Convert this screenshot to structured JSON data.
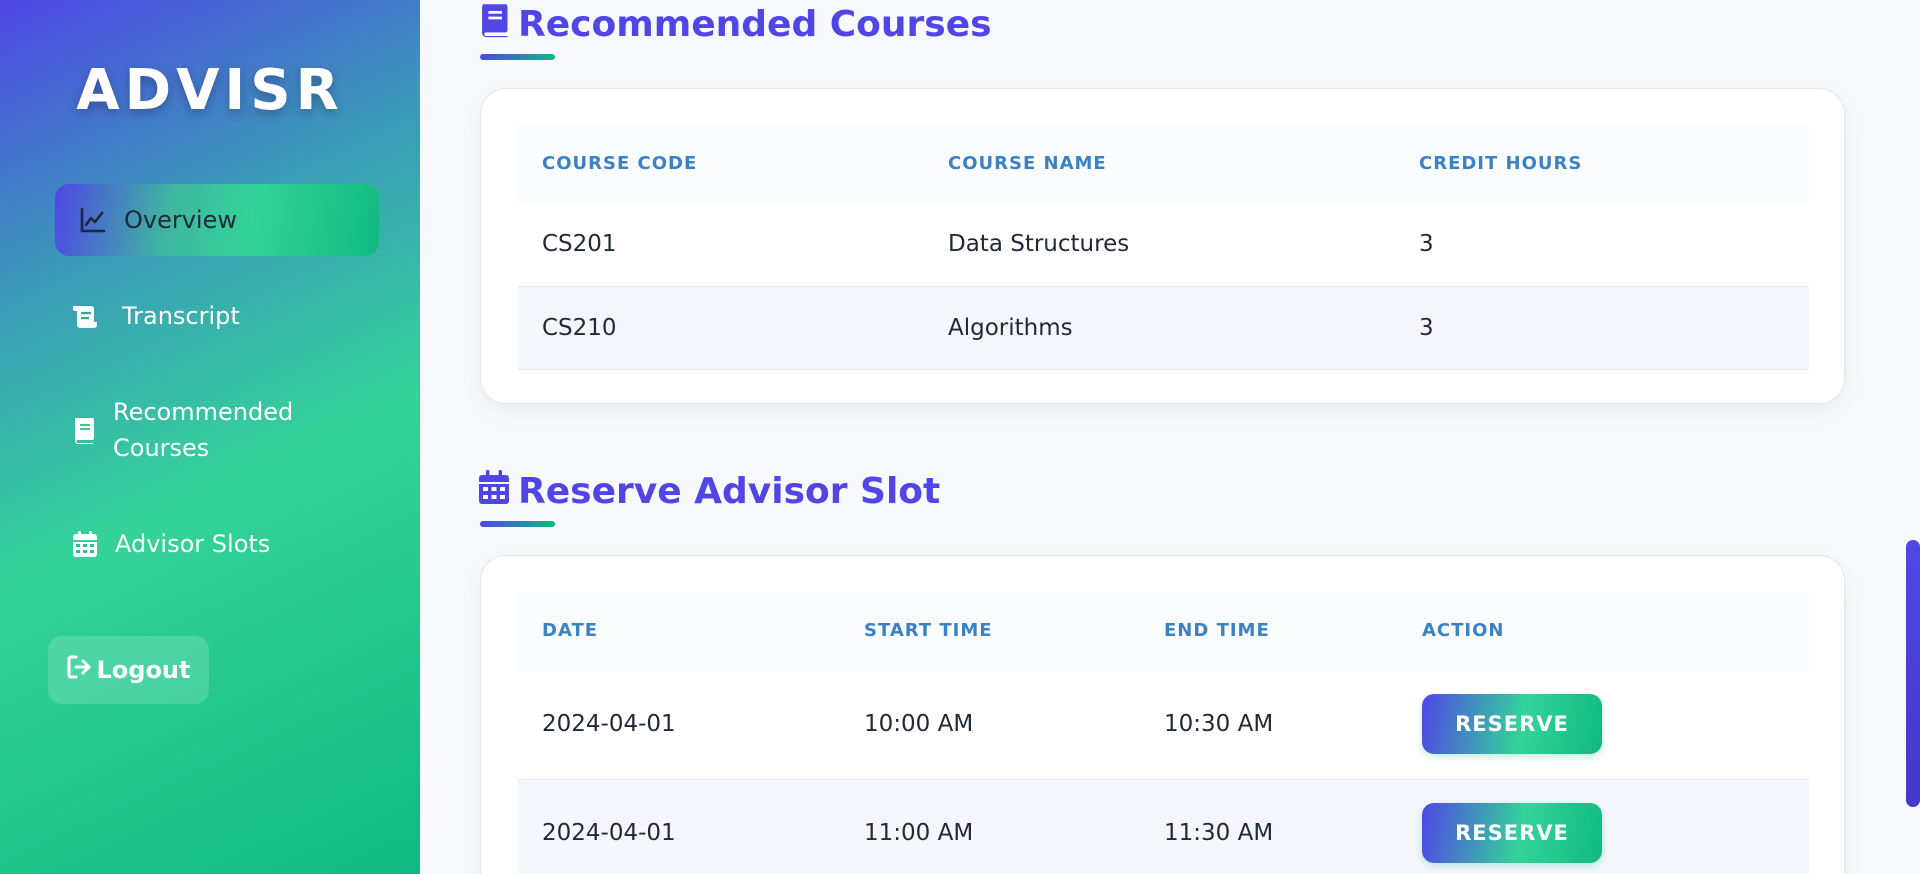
{
  "app": {
    "logo": "ADVISR"
  },
  "sidebar": {
    "items": [
      {
        "label": "Overview",
        "icon": "chart-line-icon"
      },
      {
        "label": "Transcript",
        "icon": "scroll-icon"
      },
      {
        "label": "Recommended Courses",
        "icon": "book-icon"
      },
      {
        "label": "Advisor Slots",
        "icon": "calendar-icon"
      }
    ],
    "logout": {
      "label": "Logout",
      "icon": "sign-out-icon"
    }
  },
  "recommended": {
    "title": "Recommended Courses",
    "columns": [
      "COURSE CODE",
      "COURSE NAME",
      "CREDIT HOURS"
    ],
    "rows": [
      {
        "code": "CS201",
        "name": "Data Structures",
        "credits": "3"
      },
      {
        "code": "CS210",
        "name": "Algorithms",
        "credits": "3"
      }
    ]
  },
  "reserve": {
    "title": "Reserve Advisor Slot",
    "columns": [
      "DATE",
      "START TIME",
      "END TIME",
      "ACTION"
    ],
    "rows": [
      {
        "date": "2024-04-01",
        "start": "10:00 AM",
        "end": "10:30 AM",
        "action": "RESERVE"
      },
      {
        "date": "2024-04-01",
        "start": "11:00 AM",
        "end": "11:30 AM",
        "action": "RESERVE"
      }
    ]
  },
  "colors": {
    "accent": "#4f46e5",
    "secondary": "#10b981",
    "header_text": "#3b82c4"
  }
}
